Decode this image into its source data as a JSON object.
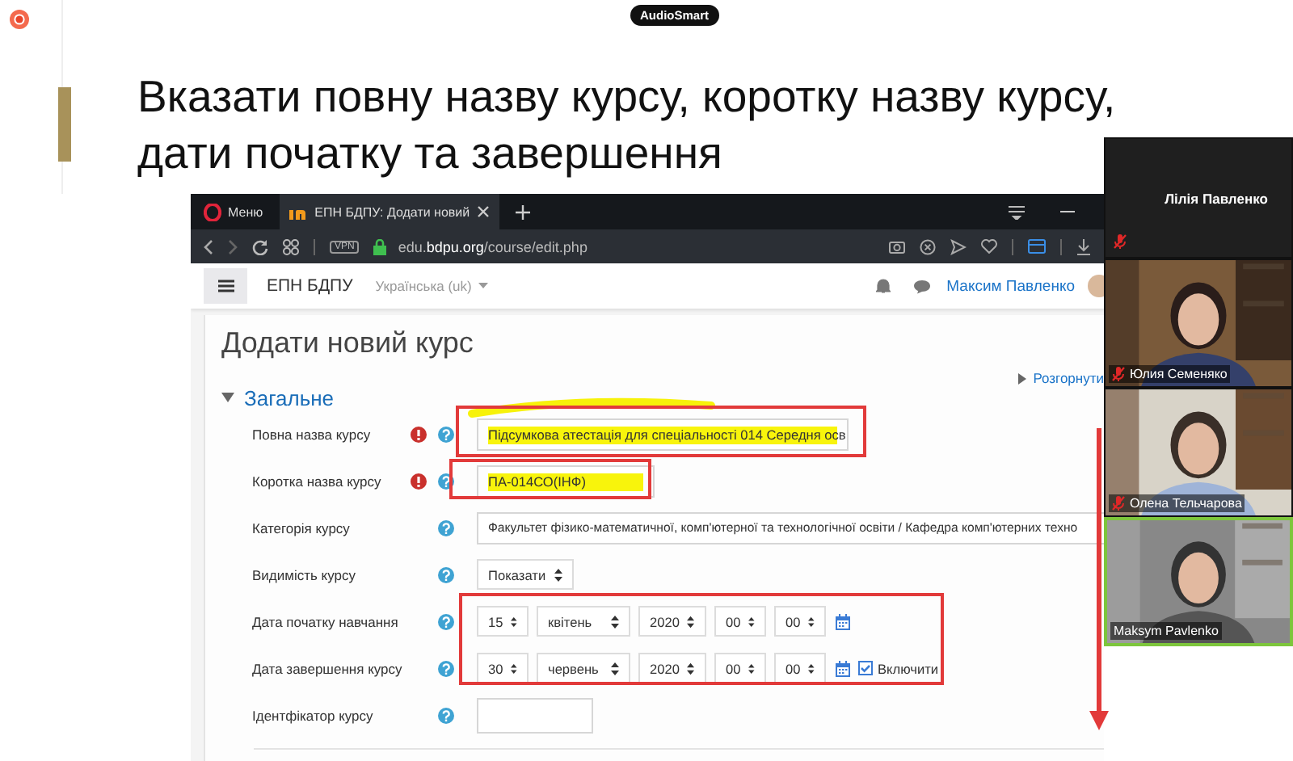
{
  "overlay_badge": {
    "label": "AudioSmart"
  },
  "slide": {
    "title": "Вказати повну назву курсу, коротку назву курсу, дати початку та завершення"
  },
  "browser": {
    "menu_label": "Меню",
    "tabs": [
      {
        "title": "ЕПН БДПУ: Додати новий",
        "selected": true
      }
    ],
    "vpn_label": "VPN",
    "url": "edu.**bdpu.org**/course/edit.php"
  },
  "site": {
    "name": "ЕПН БДПУ",
    "language": "Українська (uk)",
    "user": "Максим Павленко"
  },
  "page": {
    "heading": "Додати новий курс",
    "expand_link": "Розгорнути",
    "section": {
      "title": "Загальне",
      "expanded": true
    }
  },
  "fields": [
    {
      "kind": "text",
      "label": "Повна назва курсу",
      "required": true,
      "value": "Підсумкова атестація для спеціальності 014 Середня осв",
      "highlighted": true
    },
    {
      "kind": "text",
      "label": "Коротка назва курсу",
      "required": true,
      "value": "ПА-014СО(ІНФ)",
      "highlighted": true
    },
    {
      "kind": "text",
      "label": "Категорія курсу",
      "required": false,
      "value": "Факультет фізико-математичної, комп'ютерної та технологічної освіти / Кафедра комп'ютерних техно"
    },
    {
      "kind": "select",
      "label": "Видимість курсу",
      "required": false,
      "value": "Показати"
    },
    {
      "kind": "date",
      "label": "Дата початку навчання",
      "required": false,
      "day": "15",
      "month": "квітень",
      "year": "2020",
      "hour": "00",
      "minute": "00"
    },
    {
      "kind": "date",
      "label": "Дата завершення курсу",
      "required": false,
      "day": "30",
      "month": "червень",
      "year": "2020",
      "hour": "00",
      "minute": "00",
      "enable": {
        "label": "Включити",
        "checked": true
      }
    },
    {
      "kind": "text",
      "label": "Ідентфікатор курсу",
      "required": false
    }
  ],
  "participants": [
    {
      "name": "Лілія Павленко",
      "video": false,
      "muted": true,
      "speaking": false
    },
    {
      "name": "Юлия Семеняко",
      "video": true,
      "muted": true,
      "speaking": false
    },
    {
      "name": "Олена Тельчарова",
      "video": true,
      "muted": true,
      "speaking": false
    },
    {
      "name": "Maksym Pavlenko",
      "video": true,
      "muted": false,
      "speaking": true
    }
  ]
}
